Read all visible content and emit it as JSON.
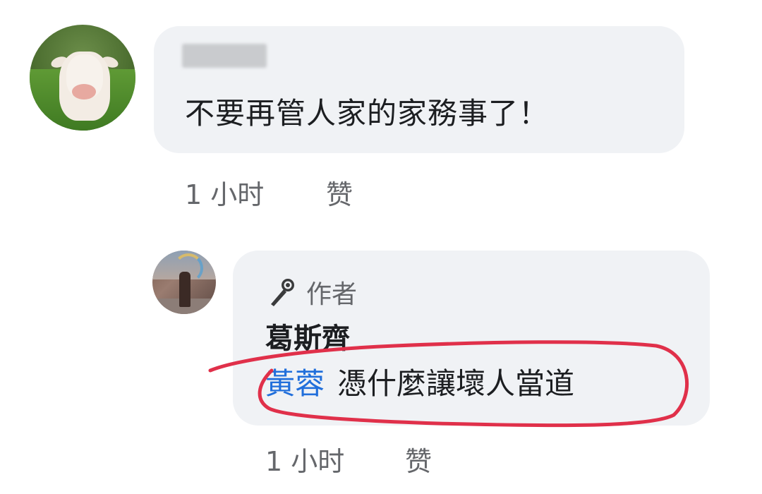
{
  "comments": [
    {
      "author": "",
      "text": "不要再管人家的家務事了！",
      "time": "1 小时",
      "like_label": "赞"
    }
  ],
  "reply": {
    "badge_label": "作者",
    "author": "葛斯齊",
    "mention": "黃蓉",
    "text": "憑什麼讓壞人當道",
    "time": "1 小时",
    "like_label": "赞"
  },
  "colors": {
    "bubble": "#f0f2f5",
    "meta": "#65676b",
    "mention": "#216fdb",
    "annotation": "#e0304a"
  },
  "icons": {
    "author_badge": "microphone-icon"
  }
}
